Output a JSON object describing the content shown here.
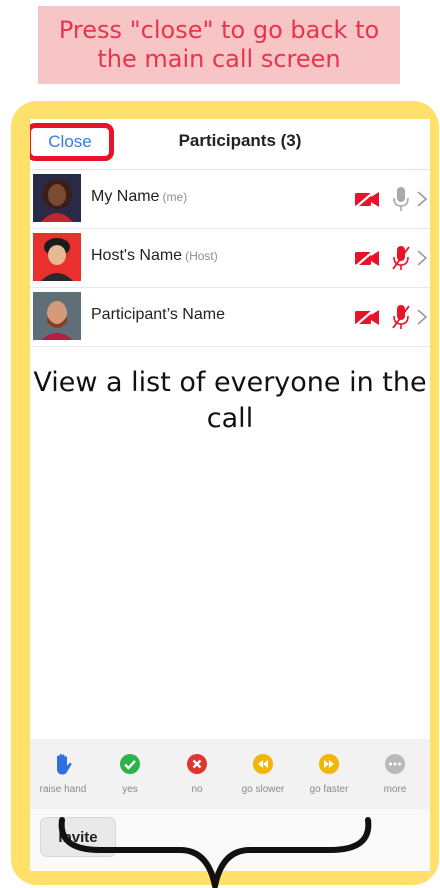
{
  "banner": {
    "text": "Press \"close\" to go back to the main call screen"
  },
  "header": {
    "close_label": "Close",
    "title": "Participants (3)"
  },
  "participants": [
    {
      "name": "My Name",
      "tag": "(me)",
      "video": "off",
      "mic": "on"
    },
    {
      "name": "Host's Name",
      "tag": "(Host)",
      "video": "off",
      "mic": "muted"
    },
    {
      "name": "Participant’s Name",
      "tag": "",
      "video": "off",
      "mic": "muted"
    }
  ],
  "caption": "View a list of everyone in the call",
  "reactions": [
    {
      "label": "raise hand",
      "icon": "raise-hand-icon",
      "color": "#2f6fe0"
    },
    {
      "label": "yes",
      "icon": "check-icon",
      "color": "#2bb24c"
    },
    {
      "label": "no",
      "icon": "x-icon",
      "color": "#e0342f"
    },
    {
      "label": "go slower",
      "icon": "rewind-icon",
      "color": "#f2b705"
    },
    {
      "label": "go faster",
      "icon": "fast-forward-icon",
      "color": "#f2b705"
    },
    {
      "label": "more",
      "icon": "more-icon",
      "color": "#b9b9b9"
    }
  ],
  "invite_label": "Invite",
  "colors": {
    "frame": "#ffe06a",
    "banner_bg": "#f7c5c5",
    "banner_text": "#e8344c",
    "close_outline": "#e8122a",
    "close_text": "#2f7ee6",
    "muted_red": "#e8122a"
  }
}
